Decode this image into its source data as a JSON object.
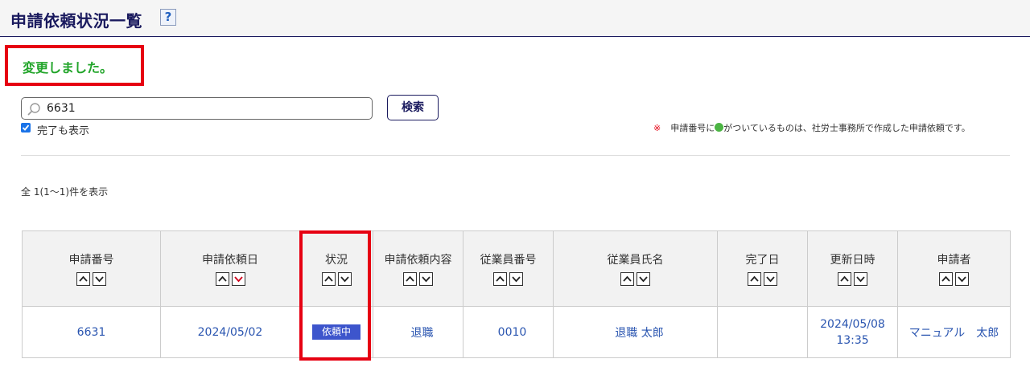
{
  "header": {
    "title": "申請依頼状況一覧",
    "help": "?"
  },
  "message": "変更しました。",
  "search": {
    "value": "6631",
    "button": "検索"
  },
  "filter": {
    "show_completed": "完了も表示"
  },
  "note": {
    "mark": "※",
    "before": "申請番号に",
    "after": "がついているものは、社労士事務所で作成した申請依頼です。"
  },
  "count": "全 1(1～1)件を表示",
  "table": {
    "headers": [
      "申請番号",
      "申請依頼日",
      "状況",
      "申請依頼内容",
      "従業員番号",
      "従業員氏名",
      "完了日",
      "更新日時",
      "申請者"
    ],
    "rows": [
      {
        "id": "6631",
        "request_date": "2024/05/02",
        "status": "依頼中",
        "content": "退職",
        "employee_no": "0010",
        "employee_name": "退職 太郎",
        "completed": "",
        "updated_date": "2024/05/08",
        "updated_time": "13:35",
        "requester": "マニュアル　太郎"
      }
    ]
  },
  "colors": {
    "accent": "#1a1a5e",
    "success": "#22a52a",
    "highlight": "#e60012",
    "badge": "#3d55cc",
    "link": "#2a55b0"
  }
}
